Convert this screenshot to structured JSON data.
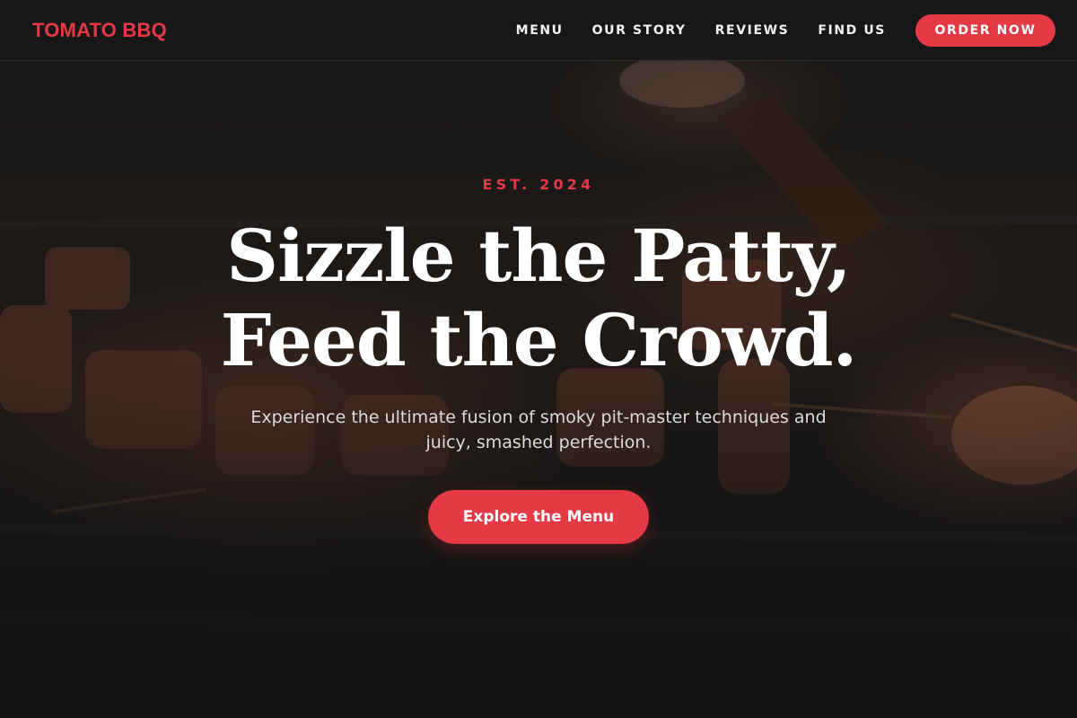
{
  "brand": {
    "name": "TOMATO BBQ",
    "accent_color": "#e63946"
  },
  "nav": {
    "links": [
      "MENU",
      "OUR STORY",
      "REVIEWS",
      "FIND US"
    ],
    "order_label": "ORDER NOW"
  },
  "hero": {
    "eyebrow": "EST. 2024",
    "headline_line1": "Sizzle the Patty,",
    "headline_line2": "Feed the Crowd.",
    "subtext": "Experience the ultimate fusion of smoky pit-master techniques and juicy, smashed perfection.",
    "cta_label": "Explore the Menu",
    "background_image": "grilled-meat-skewers-photo"
  }
}
